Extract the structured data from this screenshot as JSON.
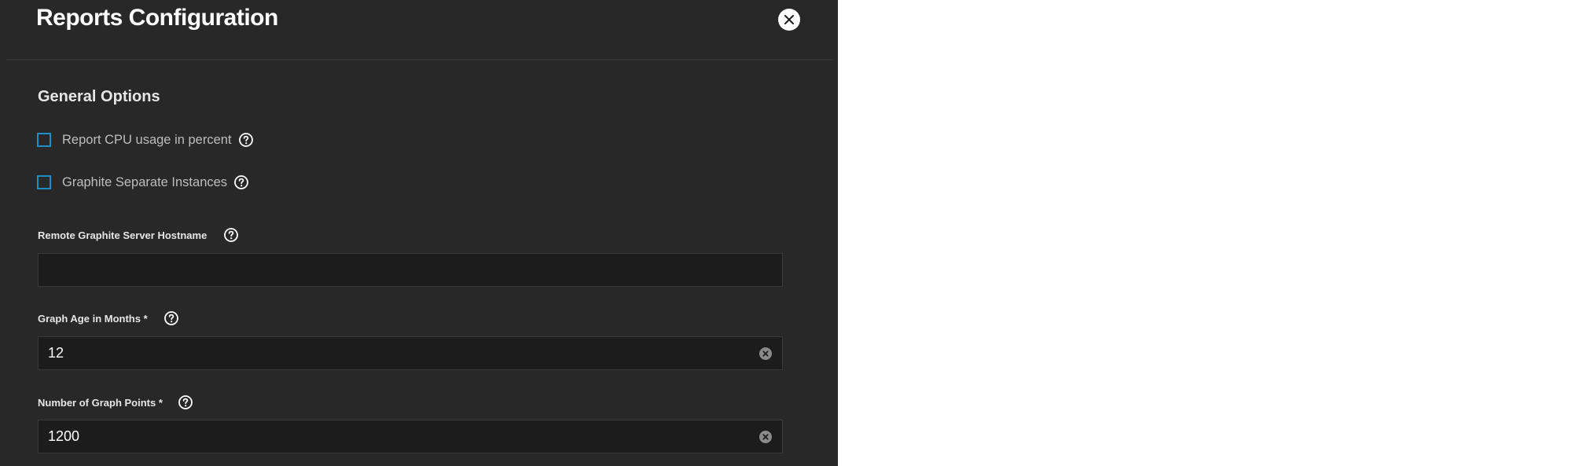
{
  "dialog": {
    "title": "Reports Configuration",
    "close_icon": "close-icon"
  },
  "general_options": {
    "heading": "General Options",
    "checkboxes": [
      {
        "label": "Report CPU usage in percent",
        "checked": false,
        "icon": "help-icon"
      },
      {
        "label": "Graphite Separate Instances",
        "checked": false,
        "icon": "help-icon"
      }
    ]
  },
  "fields": {
    "hostname": {
      "label": "Remote Graphite Server Hostname",
      "value": "",
      "icon": "help-icon"
    },
    "graph_age": {
      "label": "Graph Age in Months *",
      "value": "12",
      "icon": "help-icon",
      "clear_icon": "clear-icon"
    },
    "graph_points": {
      "label": "Number of Graph Points *",
      "value": "1200",
      "icon": "help-icon",
      "clear_icon": "clear-icon"
    }
  },
  "colors": {
    "panel_bg": "#282828",
    "input_bg": "#1c1c1c",
    "checkbox_border": "#1d8fc9",
    "text_primary": "#ffffff"
  }
}
